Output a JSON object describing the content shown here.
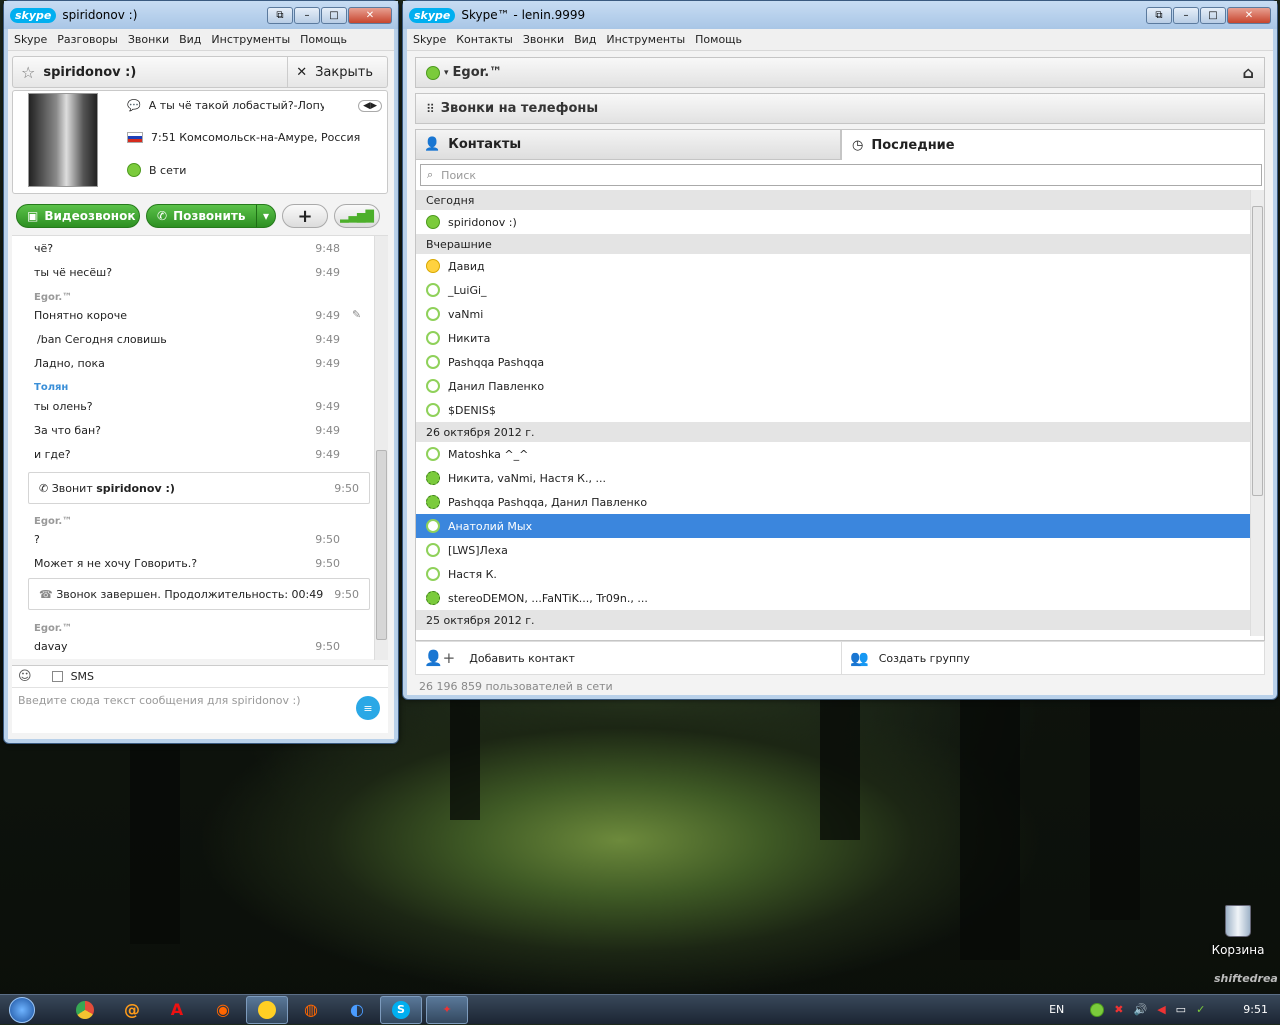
{
  "chat_window": {
    "title": "spiridonov :)",
    "menu": [
      "Skype",
      "Разговоры",
      "Звонки",
      "Вид",
      "Инструменты",
      "Помощь"
    ],
    "contact_name": "spiridonov :)",
    "close_label": "Закрыть",
    "mood": "А ты чё такой лобастый?-Лопух...",
    "location": "7:51 Комсомольск-на-Амуре, Россия",
    "status": "В сети",
    "video_call": "Видеозвонок",
    "call": "Позвонить",
    "messages": [
      {
        "text": "чё?",
        "time": "9:48"
      },
      {
        "text": "ты чё несёш?",
        "time": "9:49"
      },
      {
        "sender": "Egor.™"
      },
      {
        "text": "Понятно короче",
        "time": "9:49"
      },
      {
        "text": "/ban Сегодня словишь",
        "time": "9:49"
      },
      {
        "text": "Ладно, пока",
        "time": "9:49"
      },
      {
        "sender": "Толян"
      },
      {
        "text": "ты олень?",
        "time": "9:49"
      },
      {
        "text": "За что бан?",
        "time": "9:49"
      },
      {
        "text": "и где?",
        "time": "9:49"
      },
      {
        "call_text_prefix": "Звонит",
        "call_text_name": "spiridonov :)",
        "time": "9:50"
      },
      {
        "sender": "Egor.™"
      },
      {
        "text": "?",
        "time": "9:50"
      },
      {
        "text": "Может я не хочу Говорить.?",
        "time": "9:50"
      },
      {
        "call_end": "Звонок завершен. Продолжительность: 00:49",
        "time": "9:50"
      },
      {
        "sender": "Egor.™"
      },
      {
        "text": "davay",
        "time": "9:50"
      }
    ],
    "sms_label": "SMS",
    "input_placeholder": "Введите сюда текст сообщения для spiridonov :)"
  },
  "main_window": {
    "title": "Skype™ - lenin.9999",
    "menu": [
      "Skype",
      "Контакты",
      "Звонки",
      "Вид",
      "Инструменты",
      "Помощь"
    ],
    "user": "Egor.™",
    "phone_calls": "Звонки на телефоны",
    "tab_contacts": "Контакты",
    "tab_recent": "Последние",
    "search_placeholder": "Поиск",
    "groups": [
      {
        "header": "Сегодня",
        "items": [
          {
            "name": "spiridonov :)",
            "status": "on"
          }
        ]
      },
      {
        "header": "Вчерашние",
        "items": [
          {
            "name": "Давид",
            "status": "away"
          },
          {
            "name": "_LuiGi_",
            "status": "off"
          },
          {
            "name": "vaNmi",
            "status": "off"
          },
          {
            "name": "Никита",
            "status": "off"
          },
          {
            "name": "Pashqqa Pashqqa",
            "status": "off"
          },
          {
            "name": "Данил Павленко",
            "status": "off"
          },
          {
            "name": "$DENIS$",
            "status": "off"
          }
        ]
      },
      {
        "header": "26 октября 2012 г.",
        "items": [
          {
            "name": "Matoshka ^_^",
            "status": "off"
          },
          {
            "name": "Никита, vaNmi, Настя К., ...",
            "status": "grp"
          },
          {
            "name": "Pashqqa Pashqqa, Данил Павленко",
            "status": "grp"
          },
          {
            "name": "Анатолий Мых",
            "status": "off",
            "selected": true
          },
          {
            "name": "[LWS]Леха",
            "status": "off"
          },
          {
            "name": "Настя К.",
            "status": "off"
          },
          {
            "name": "stereoDEMON, ...FaNTiK..., Tr09n., ...",
            "status": "grp"
          }
        ]
      },
      {
        "header": "25 октября 2012 г.",
        "items": []
      }
    ],
    "add_contact": "Добавить контакт",
    "create_group": "Создать группу",
    "online_count": "26 196 859 пользователей в сети"
  },
  "desktop": {
    "recycle_bin": "Корзина",
    "watermark": "shiftedrea"
  },
  "taskbar": {
    "lang": "EN",
    "clock": "9:51"
  }
}
